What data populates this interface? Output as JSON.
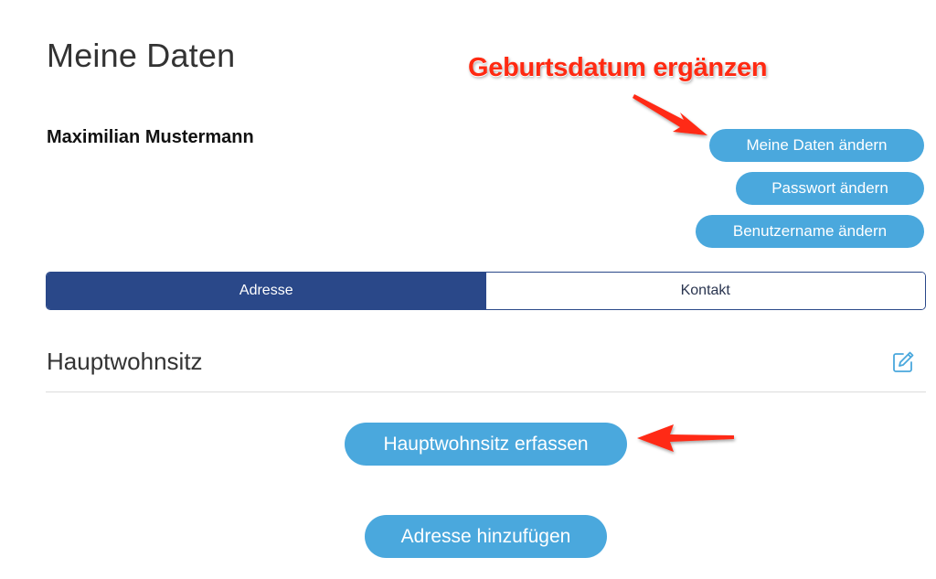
{
  "header": {
    "title": "Meine Daten"
  },
  "user": {
    "name": "Maximilian Mustermann"
  },
  "actions": {
    "edit_data_label": "Meine Daten ändern",
    "change_password_label": "Passwort ändern",
    "change_username_label": "Benutzername ändern"
  },
  "tabs": [
    {
      "label": "Adresse",
      "active": true
    },
    {
      "label": "Kontakt",
      "active": false
    }
  ],
  "section": {
    "title": "Hauptwohnsitz",
    "edit_icon": "edit-icon",
    "add_main_residence_label": "Hauptwohnsitz erfassen",
    "add_address_label": "Adresse hinzufügen"
  },
  "annotation": {
    "text": "Geburtsdatum ergänzen",
    "color": "#ff2a12"
  },
  "colors": {
    "button": "#4aa8dd",
    "tab_active": "#2a4889",
    "text": "#333333"
  }
}
